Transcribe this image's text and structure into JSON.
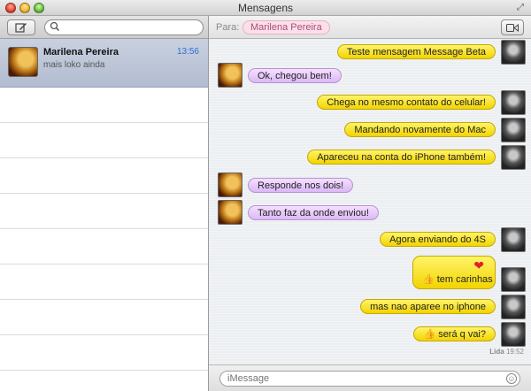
{
  "window": {
    "title": "Mensagens"
  },
  "search": {
    "placeholder": ""
  },
  "conversation": {
    "name": "Marilena Pereira",
    "time": "13:56",
    "preview": "mais loko ainda"
  },
  "header": {
    "to_label": "Para:",
    "recipient": "Marilena Pereira"
  },
  "messages": [
    {
      "from": "me",
      "text": "Teste mensagem Message Beta"
    },
    {
      "from": "her",
      "text": "Ok, chegou bem!"
    },
    {
      "from": "me",
      "text": "Chega no mesmo contato do celular!"
    },
    {
      "from": "me",
      "text": "Mandando novamente do Mac"
    },
    {
      "from": "me",
      "text": "Apareceu na conta do iPhone também!"
    },
    {
      "from": "her",
      "text": "Responde nos dois!"
    },
    {
      "from": "her",
      "text": "Tanto faz da onde enviou!"
    },
    {
      "from": "me",
      "text": "Agora enviando do 4S"
    },
    {
      "from": "me",
      "text": "tem carinhas"
    },
    {
      "from": "me",
      "text": "mas nao aparee no iphone"
    },
    {
      "from": "me",
      "text": "será q vai?"
    }
  ],
  "read_status": {
    "label": "Lida",
    "time": "19:52"
  },
  "input": {
    "placeholder": "iMessage"
  },
  "colors": {
    "outgoing": "#f2d400",
    "incoming": "#dcb8f6",
    "selection": "#b2bcd0",
    "time_accent": "#2a6fd1"
  }
}
